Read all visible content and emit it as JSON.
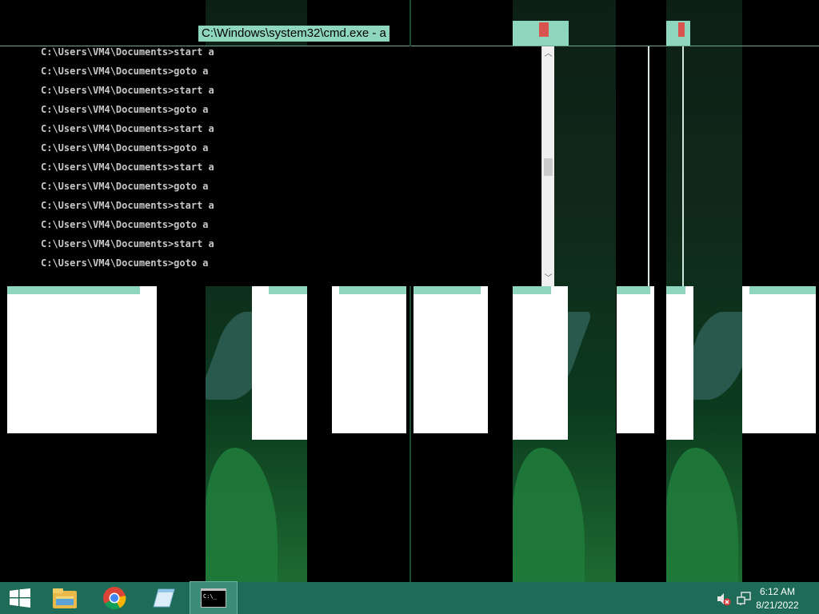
{
  "cmd_window": {
    "title": "C:\\Windows\\system32\\cmd.exe - a",
    "lines": [
      "C:\\Users\\VM4\\Documents>start a",
      "C:\\Users\\VM4\\Documents>goto a",
      "C:\\Users\\VM4\\Documents>start a",
      "C:\\Users\\VM4\\Documents>goto a",
      "C:\\Users\\VM4\\Documents>start a",
      "C:\\Users\\VM4\\Documents>goto a",
      "C:\\Users\\VM4\\Documents>start a",
      "C:\\Users\\VM4\\Documents>goto a",
      "C:\\Users\\VM4\\Documents>start a",
      "C:\\Users\\VM4\\Documents>goto a",
      "C:\\Users\\VM4\\Documents>start a",
      "C:\\Users\\VM4\\Documents>goto a"
    ]
  },
  "taskbar": {
    "items": [
      {
        "icon": "windows-start-icon"
      },
      {
        "icon": "file-explorer-icon"
      },
      {
        "icon": "chrome-icon"
      },
      {
        "icon": "notepad-icon"
      },
      {
        "icon": "cmd-icon",
        "active": true
      }
    ],
    "tray": {
      "volume_icon": "volume-muted-icon",
      "network_icon": "network-icon",
      "time": "6:12 AM",
      "date": "8/21/2022"
    }
  },
  "colors": {
    "accent_mint": "#8fd6be",
    "taskbar": "#1e6b58",
    "console_bg": "#000000",
    "console_text": "#c8c8c8"
  }
}
